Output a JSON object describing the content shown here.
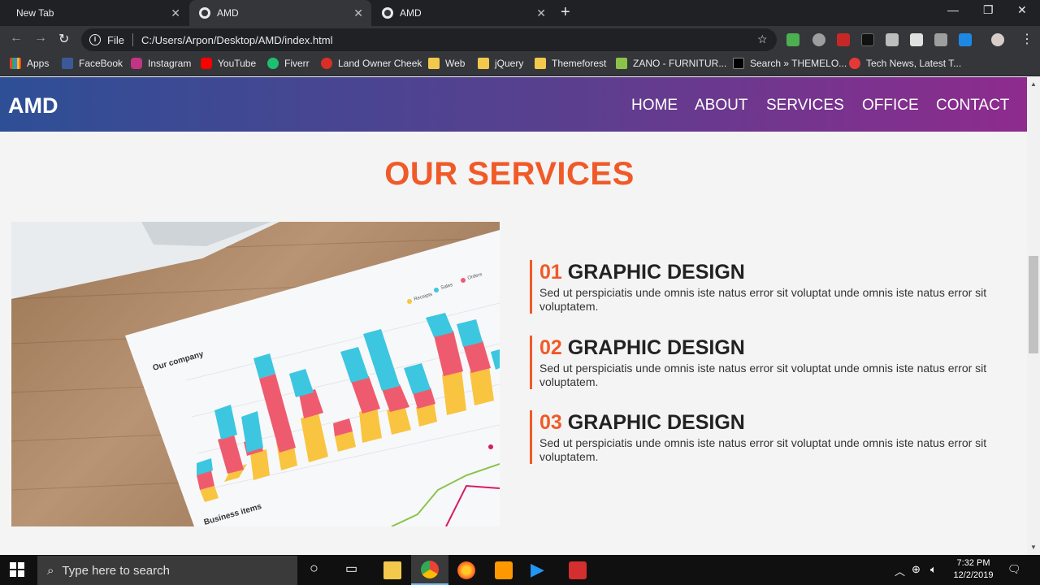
{
  "browser": {
    "tabs": [
      {
        "label": "New Tab"
      },
      {
        "label": "AMD"
      },
      {
        "label": "AMD"
      }
    ],
    "omnibox": {
      "prefix": "File",
      "url": "C:/Users/Arpon/Desktop/AMD/index.html"
    },
    "bookmarks": [
      {
        "label": "Apps",
        "color": "#4285f4"
      },
      {
        "label": "FaceBook",
        "color": "#3b5998"
      },
      {
        "label": "Instagram",
        "color": "#c13584"
      },
      {
        "label": "YouTube",
        "color": "#ff0000"
      },
      {
        "label": "Fiverr",
        "color": "#1dbf73"
      },
      {
        "label": "Land Owner Cheek",
        "color": "#d93025"
      },
      {
        "label": "Web",
        "color": "#f2c94c"
      },
      {
        "label": "jQuery",
        "color": "#f2c94c"
      },
      {
        "label": "Themeforest",
        "color": "#f2c94c"
      },
      {
        "label": "ZANO - FURNITUR...",
        "color": "#8bc34a"
      },
      {
        "label": "Search » THEMELO...",
        "color": "#000000"
      },
      {
        "label": "Tech News, Latest T...",
        "color": "#e53935"
      }
    ]
  },
  "site": {
    "logo": "AMD",
    "nav": [
      "HOME",
      "ABOUT",
      "SERVICES",
      "OFFICE",
      "CONTACT"
    ],
    "section_title": "OUR SERVICES",
    "services": [
      {
        "num": "01",
        "title": "GRAPHIC DESIGN",
        "text": "Sed ut perspiciatis unde omnis iste natus error sit voluptat unde omnis iste natus error sit voluptatem."
      },
      {
        "num": "02",
        "title": "GRAPHIC DESIGN",
        "text": "Sed ut perspiciatis unde omnis iste natus error sit voluptat unde omnis iste natus error sit voluptatem."
      },
      {
        "num": "03",
        "title": "GRAPHIC DESIGN",
        "text": "Sed ut perspiciatis unde omnis iste natus error sit voluptat unde omnis iste natus error sit voluptatem."
      }
    ],
    "image_text": {
      "company": "Our company",
      "business": "Business items",
      "legend": [
        "Receipts",
        "Sales",
        "Orders"
      ]
    },
    "accent": "#f05a28"
  },
  "taskbar": {
    "search_placeholder": "Type here to search",
    "time": "7:32 PM",
    "date": "12/2/2019"
  }
}
